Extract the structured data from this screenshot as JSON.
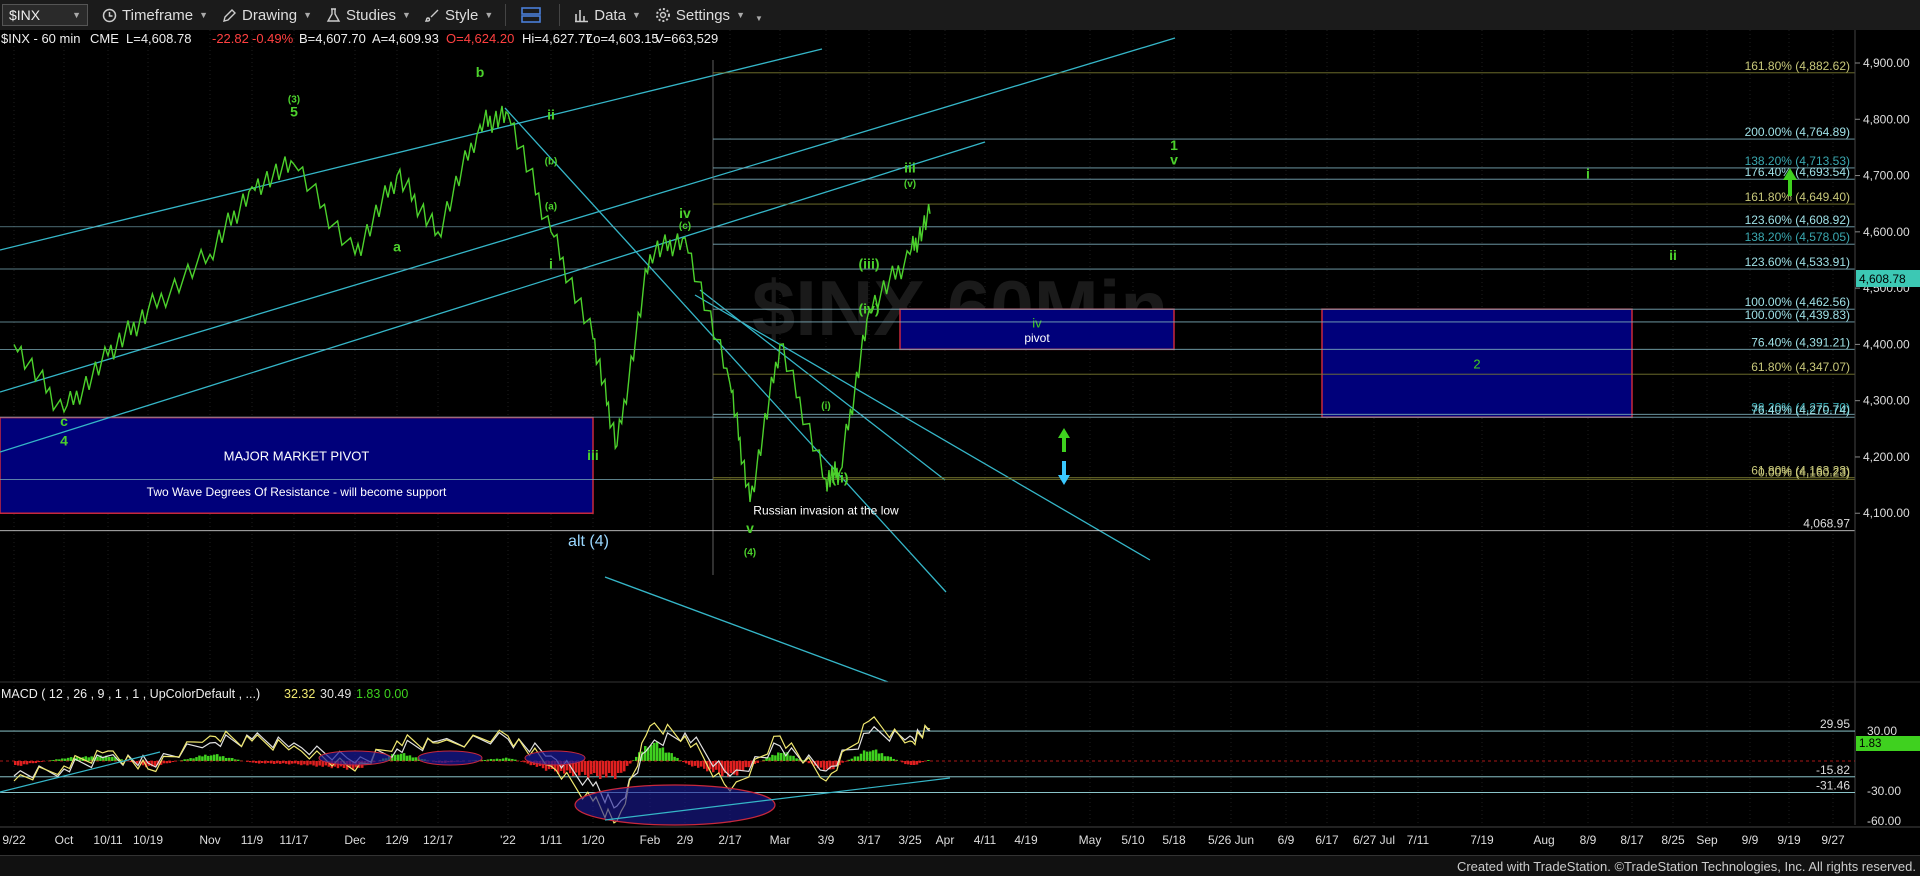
{
  "toolbar": {
    "symbol": "$INX",
    "timeframe": "Timeframe",
    "drawing": "Drawing",
    "studies": "Studies",
    "style": "Style",
    "data": "Data",
    "settings": "Settings"
  },
  "footer": {
    "credit": "Created with TradeStation. ©TradeStation Technologies, Inc. All rights reserved."
  },
  "colors": {
    "background": "#000000",
    "price": "#4cd12c",
    "wave_label": "#4cd12c",
    "fib": "#9ee0e6",
    "fib_gold": "#c8c87a",
    "channel": "#35b6c8",
    "zone_fill": "#00007a",
    "zone_border": "#c8283c",
    "macd_line": "#f0e870",
    "signal_line": "#e0e0e0",
    "hist_pos": "#3fd11f",
    "hist_neg": "#e02020"
  },
  "chart_data": {
    "type": "line",
    "title": "$INX - 60 min",
    "header": {
      "symbol": "$INX - 60 min",
      "exchange": "CME",
      "last": "L=4,608.78",
      "change": "-22.82",
      "change_pct": "-0.49%",
      "bid": "B=4,607.70",
      "ask": "A=4,609.93",
      "open": "O=4,624.20",
      "high": "Hi=4,627.77",
      "low": "Lo=4,603.15",
      "volume": "V=663,529"
    },
    "watermark": "$INX 60Min",
    "x_ticks": [
      "9/22",
      "Oct",
      "10/11",
      "10/19",
      "Nov",
      "11/9",
      "11/17",
      "Dec",
      "12/9",
      "12/17",
      "'22",
      "1/11",
      "1/20",
      "Feb",
      "2/9",
      "2/17",
      "Mar",
      "3/9",
      "3/17",
      "3/25",
      "Apr",
      "4/11",
      "4/19",
      "May",
      "5/10",
      "5/18",
      "5/26 Jun",
      "6/9",
      "6/17",
      "6/27 Jul",
      "7/11",
      "7/19",
      "Aug",
      "8/9",
      "8/17",
      "8/25",
      "Sep",
      "9/9",
      "9/19",
      "9/27"
    ],
    "y_ticks": [
      "4,900.00",
      "4,800.00",
      "4,700.00",
      "4,600.00",
      "4,500.00",
      "4,400.00",
      "4,300.00",
      "4,200.00",
      "4,100.00"
    ],
    "ylim": [
      4000,
      4950
    ],
    "last_price_tag": "4,608.78",
    "series": [
      {
        "name": "$INX",
        "x": [
          "9/22",
          "Oct",
          "10/11",
          "10/19",
          "Nov",
          "11/9",
          "11/17",
          "Dec",
          "12/9",
          "12/17",
          "12/28",
          "'22",
          "1/11",
          "1/20",
          "1/24",
          "Feb",
          "2/9",
          "2/17",
          "2/24",
          "Mar",
          "3/9",
          "3/14",
          "3/17",
          "3/25",
          "3/29"
        ],
        "values": [
          4400,
          4280,
          4380,
          4460,
          4560,
          4680,
          4720,
          4560,
          4700,
          4600,
          4790,
          4810,
          4600,
          4410,
          4220,
          4560,
          4590,
          4330,
          4120,
          4400,
          4160,
          4175,
          4460,
          4560,
          4632
        ]
      }
    ],
    "fib_levels": [
      {
        "label": "161.80% (4,882.62)",
        "value": 4882.62,
        "tone": "gold"
      },
      {
        "label": "200.00% (4,764.89)",
        "value": 4764.89,
        "tone": "cyan"
      },
      {
        "label": "138.20% (4,713.53)",
        "value": 4713.53,
        "tone": "teal"
      },
      {
        "label": "176.40% (4,693.54)",
        "value": 4693.54,
        "tone": "cyan"
      },
      {
        "label": "161.80% (4,649.40)",
        "value": 4649.4,
        "tone": "gold"
      },
      {
        "label": "123.60% (4,608.92)",
        "value": 4608.92,
        "tone": "cyan"
      },
      {
        "label": "138.20% (4,578.05)",
        "value": 4578.05,
        "tone": "teal"
      },
      {
        "label": "123.60% (4,533.91)",
        "value": 4533.91,
        "tone": "cyan"
      },
      {
        "label": "100.00% (4,462.56)",
        "value": 4462.56,
        "tone": "cyan"
      },
      {
        "label": "100.00% (4,439.83)",
        "value": 4439.83,
        "tone": "cyan"
      },
      {
        "label": "76.40% (4,391.21)",
        "value": 4391.21,
        "tone": "cyan"
      },
      {
        "label": "61.80% (4,347.07)",
        "value": 4347.07,
        "tone": "gold"
      },
      {
        "label": "38.20% (4,275.70)",
        "value": 4275.7,
        "tone": "teal"
      },
      {
        "label": "76.40% (4,270.74)",
        "value": 4270.74,
        "tone": "cyan"
      },
      {
        "label": "61.80% (4,163.23)",
        "value": 4163.23,
        "tone": "gold"
      },
      {
        "label": "0.00% (4,160.23)",
        "value": 4160.23,
        "tone": "gold"
      },
      {
        "label": "4,068.97",
        "value": 4068.97,
        "tone": "plain"
      }
    ],
    "zones": [
      {
        "label": "MAJOR MARKET PIVOT",
        "sublabel": "Two Wave Degrees Of Resistance - will become support",
        "x_start": "9/11",
        "x_end": "1/20",
        "top": 4270,
        "bottom": 4100
      },
      {
        "label": "iv",
        "sublabel": "pivot",
        "x_start": "3/21",
        "x_end": "5/18",
        "top": 4462.56,
        "bottom": 4391.21
      },
      {
        "label": "2",
        "sublabel": "",
        "x_start": "6/22",
        "x_end": "8/17",
        "top": 4462.56,
        "bottom": 4270.74
      },
      {
        "label": "alt (4)",
        "sublabel": "",
        "x_start": "5/20",
        "x_end": "6/27",
        "top": 4068.97,
        "bottom": 4020
      }
    ],
    "annotations": [
      "(3)",
      "5",
      "b",
      "a",
      "ii",
      "iv",
      "i",
      "iii",
      "c",
      "4",
      "v",
      "(4)",
      "iii",
      "(v)",
      "(iii)",
      "(iv)",
      "(i)",
      "(ii)",
      "1",
      "v",
      "i",
      "ii",
      "(a)",
      "(b)",
      "(c)",
      "Russian invasion at the low"
    ],
    "macd": {
      "title": "MACD ( 12 , 26 , 9 , 1 , 1 , UpColorDefault , ...)",
      "value_macd": "32.32",
      "value_signal": "30.49",
      "value_hist": "1.83",
      "value_zero": "0.00",
      "y_ticks": [
        "30.00",
        "-30.00",
        "-60.00"
      ],
      "levels": [
        {
          "label": "29.95",
          "value": 29.95
        },
        {
          "label": "-15.82",
          "value": -15.82
        },
        {
          "label": "-31.46",
          "value": -31.46
        }
      ],
      "last_tag": "1.83",
      "ylim": [
        -75,
        45
      ],
      "x": [
        "9/22",
        "Oct",
        "10/11",
        "10/19",
        "Nov",
        "11/9",
        "11/17",
        "Dec",
        "12/9",
        "12/17",
        "'22",
        "1/11",
        "1/20",
        "1/24",
        "Feb",
        "2/9",
        "2/17",
        "Mar",
        "3/9",
        "3/17",
        "3/25",
        "3/29"
      ],
      "macd_values": [
        -20,
        -5,
        10,
        -8,
        25,
        20,
        15,
        -10,
        20,
        18,
        25,
        -5,
        -40,
        -60,
        35,
        25,
        -30,
        25,
        -20,
        40,
        20,
        32
      ],
      "signal_values": [
        -15,
        -8,
        5,
        -2,
        18,
        22,
        18,
        -2,
        12,
        20,
        22,
        5,
        -25,
        -45,
        15,
        28,
        -15,
        15,
        -10,
        28,
        25,
        30
      ]
    }
  }
}
